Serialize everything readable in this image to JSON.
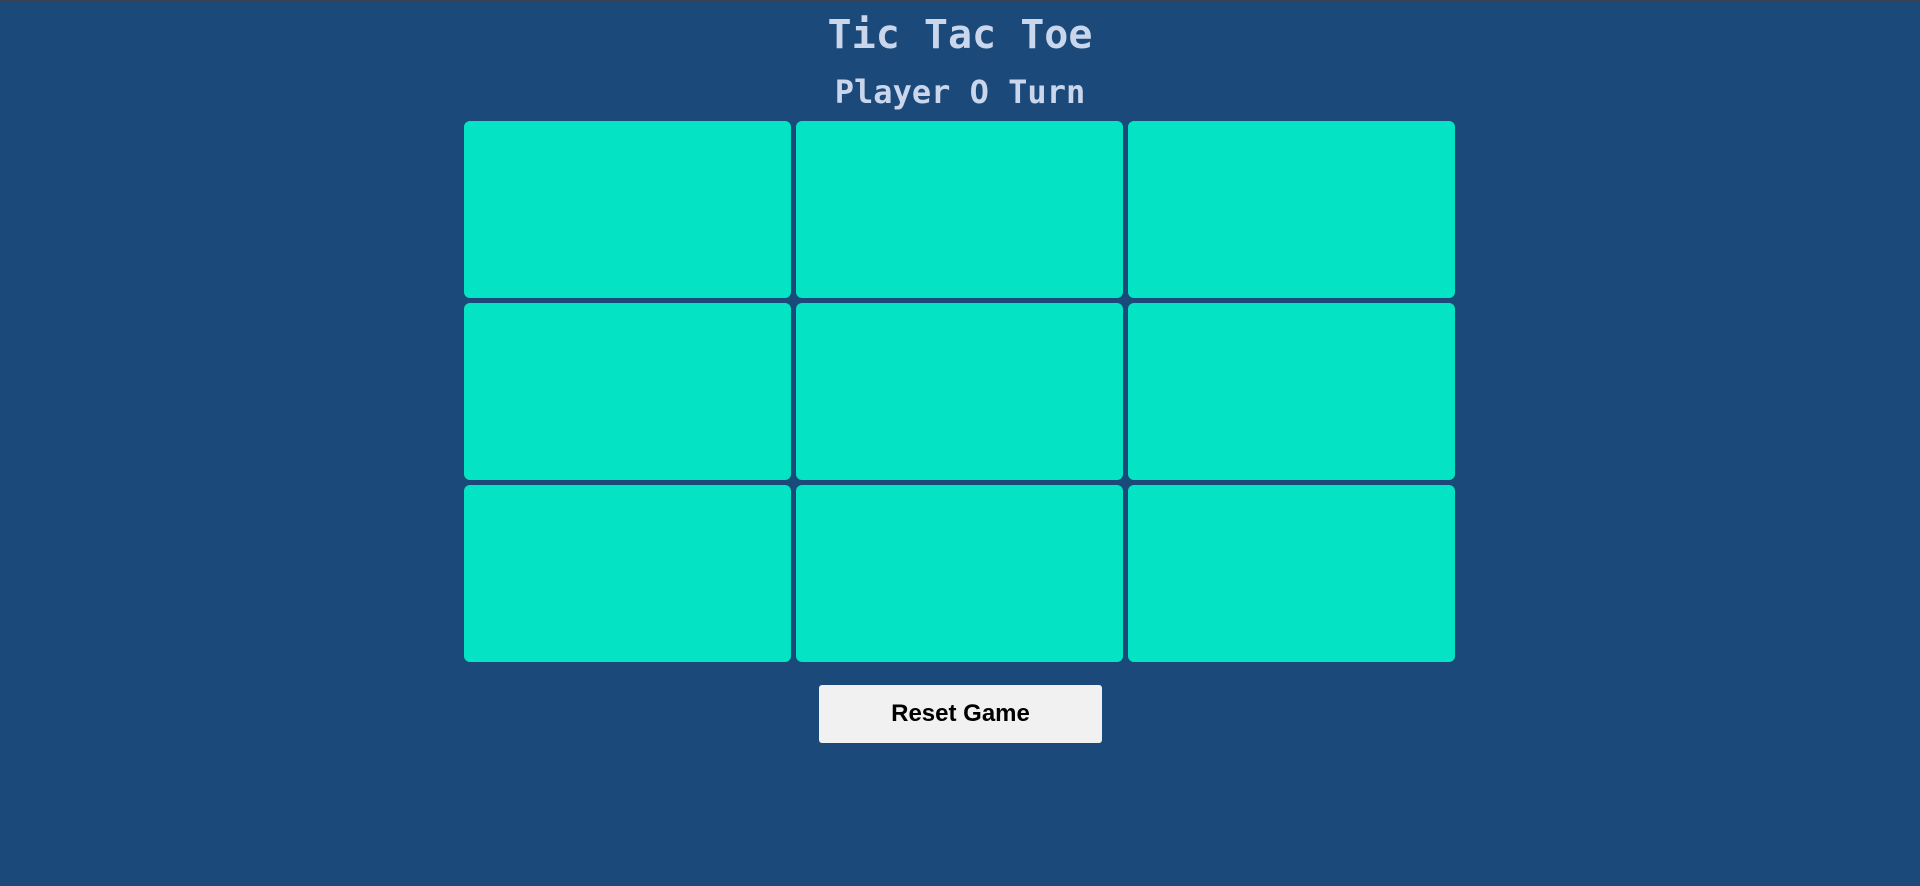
{
  "header": {
    "title": "Tic Tac Toe",
    "status": "Player O Turn"
  },
  "board": {
    "cells": [
      "",
      "",
      "",
      "",
      "",
      "",
      "",
      "",
      ""
    ]
  },
  "controls": {
    "reset_label": "Reset Game"
  },
  "colors": {
    "background": "#1b4a7a",
    "cell": "#04e4c4",
    "text": "#c9d6ec",
    "button": "#f1f1f1"
  }
}
